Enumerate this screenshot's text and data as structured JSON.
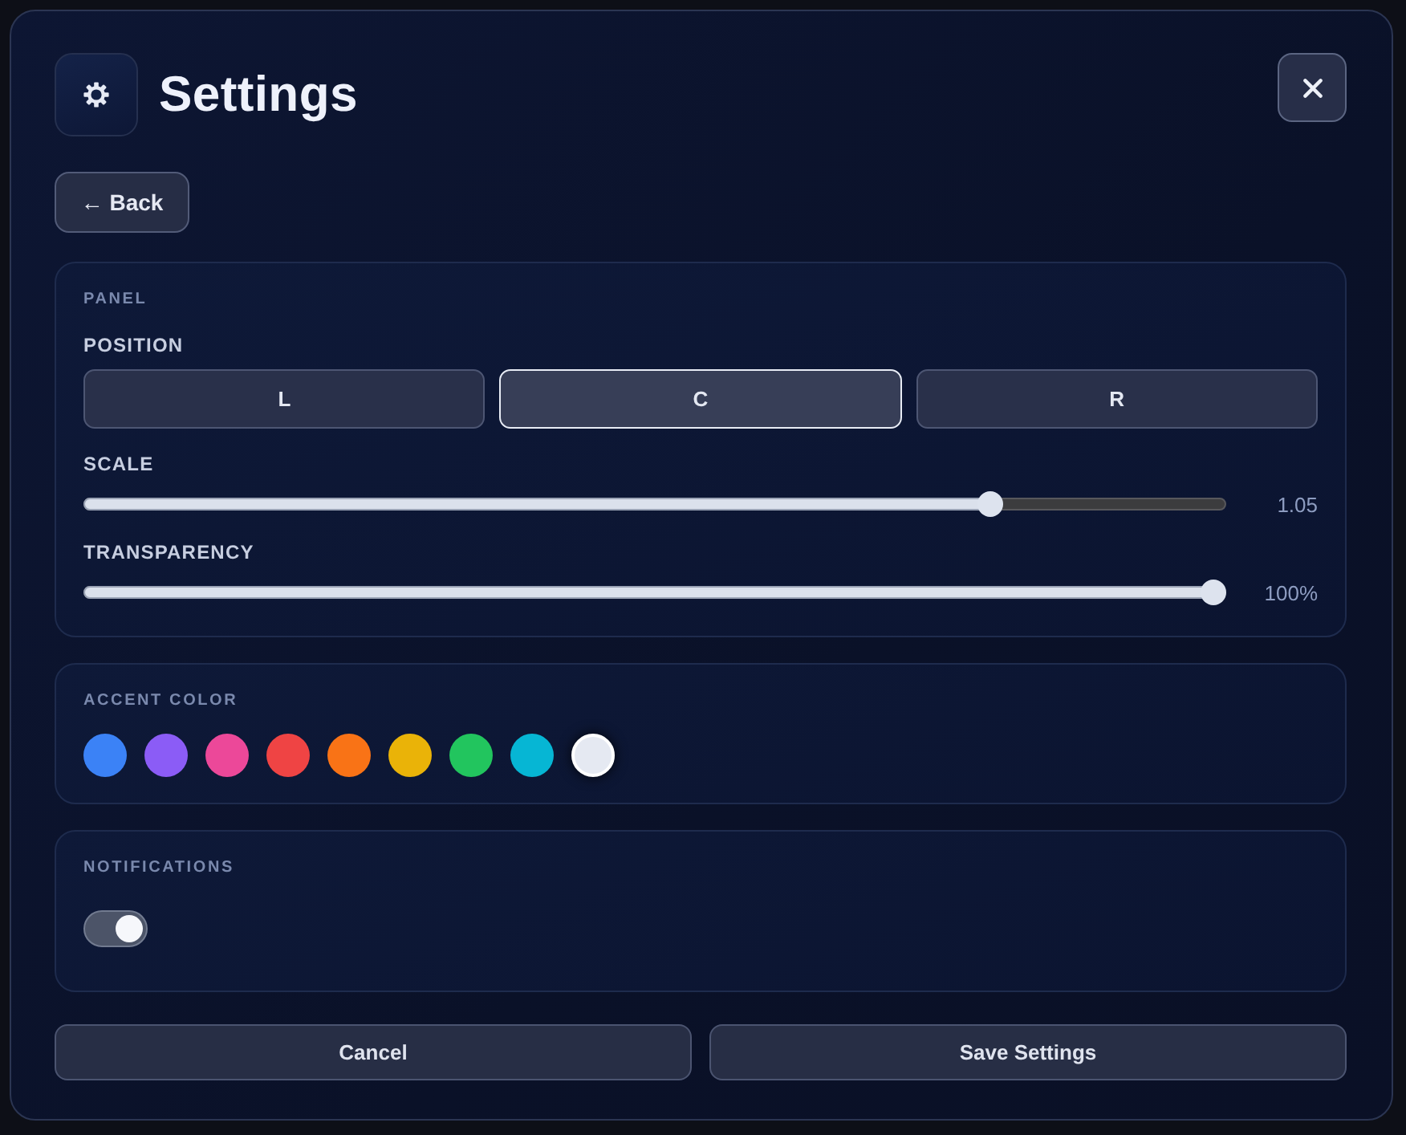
{
  "header": {
    "title": "Settings"
  },
  "back_button": {
    "label": "← Back"
  },
  "panel": {
    "heading": "PANEL",
    "position": {
      "label": "POSITION",
      "options": [
        {
          "label": "L",
          "selected": false
        },
        {
          "label": "C",
          "selected": true
        },
        {
          "label": "R",
          "selected": false
        }
      ]
    },
    "sliders": [
      {
        "label": "SCALE",
        "level": 0.8,
        "reading": "1.05"
      },
      {
        "label": "TRANSPARENCY",
        "level": 1,
        "reading": "100%"
      }
    ]
  },
  "accent_color": {
    "heading": "ACCENT COLOR",
    "swatches": [
      {
        "color": "#3b82f6",
        "selected": false
      },
      {
        "color": "#8b5cf6",
        "selected": false
      },
      {
        "color": "#ec4899",
        "selected": false
      },
      {
        "color": "#ef4444",
        "selected": false
      },
      {
        "color": "#f97316",
        "selected": false
      },
      {
        "color": "#eab308",
        "selected": false
      },
      {
        "color": "#22c55e",
        "selected": false
      },
      {
        "color": "#06b6d4",
        "selected": false
      },
      {
        "color": "#e5e9f2",
        "selected": true
      }
    ]
  },
  "notifications": {
    "heading": "NOTIFICATIONS",
    "on": true
  },
  "buttons": [
    {
      "label": "Cancel"
    },
    {
      "label": "Save Settings"
    }
  ]
}
